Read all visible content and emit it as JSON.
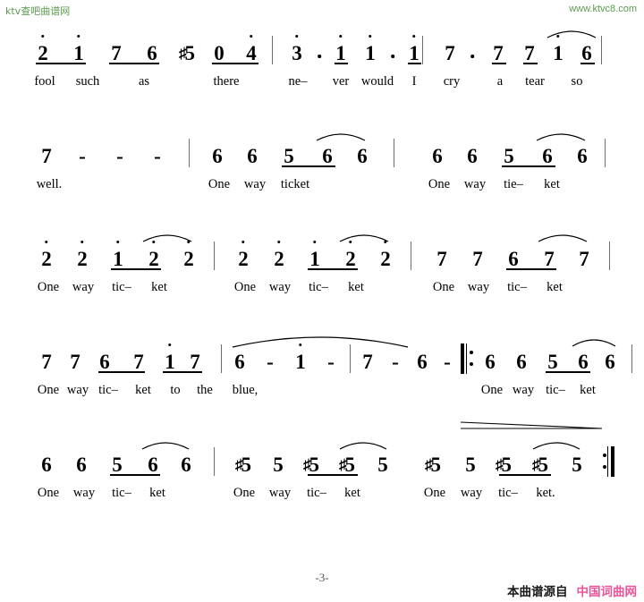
{
  "watermarks": {
    "left": "ktv查吧曲谱网",
    "right": "www.ktvc8.com",
    "left_color": "#5a9a4e",
    "right_color": "#5a9a4e"
  },
  "footer": {
    "page_number": "-3-",
    "source_label": "本曲谱源自",
    "source_site": "中国词曲网",
    "source_site_color": "#e8559a"
  },
  "score": {
    "notation": "jianpu",
    "systems": [
      {
        "index": 1,
        "measures": [
          {
            "notes": [
              {
                "num": "2",
                "octave": 1,
                "acc": "",
                "beam": "start"
              },
              {
                "num": "1",
                "octave": 1,
                "acc": "",
                "beam": "end"
              },
              {
                "num": "7",
                "octave": 0,
                "acc": "",
                "beam": "start"
              },
              {
                "num": "6",
                "octave": 0,
                "acc": "",
                "beam": "end"
              },
              {
                "num": "5",
                "octave": 0,
                "acc": "♯",
                "beam": "none"
              },
              {
                "num": "0",
                "octave": 0,
                "acc": "",
                "beam": "start"
              },
              {
                "num": "4",
                "octave": 1,
                "acc": "",
                "beam": "end"
              }
            ],
            "lyrics": [
              "fool",
              "such",
              "as",
              "there"
            ]
          },
          {
            "notes": [
              {
                "num": "3",
                "octave": 1,
                "acc": "",
                "beam": "none",
                "dotted": true
              },
              {
                "num": "1",
                "octave": 1,
                "acc": "",
                "beam": "single"
              },
              {
                "num": "1",
                "octave": 1,
                "acc": "",
                "beam": "none",
                "dotted": true
              },
              {
                "num": "1",
                "octave": 1,
                "acc": "",
                "beam": "single"
              }
            ],
            "lyrics": [
              "ne–",
              "ver",
              "would",
              "I"
            ]
          },
          {
            "notes": [
              {
                "num": "7",
                "octave": 0,
                "acc": "",
                "beam": "none",
                "dotted": true
              },
              {
                "num": "7",
                "octave": 0,
                "acc": "",
                "beam": "single"
              },
              {
                "num": "7",
                "octave": 0,
                "acc": "",
                "beam": "single"
              },
              {
                "num": "1",
                "octave": 1,
                "acc": "",
                "beam": "none"
              },
              {
                "num": "6",
                "octave": 0,
                "acc": "",
                "beam": "single"
              }
            ],
            "lyrics": [
              "cry",
              "a",
              "tear",
              "so"
            ],
            "slur": true
          }
        ]
      },
      {
        "index": 2,
        "measures": [
          {
            "notes": [
              {
                "num": "7",
                "octave": 0,
                "acc": "",
                "beam": "none"
              },
              {
                "num": "-"
              },
              {
                "num": "-"
              },
              {
                "num": "-"
              }
            ],
            "lyrics": [
              "well."
            ]
          },
          {
            "notes": [
              {
                "num": "6",
                "octave": 0,
                "acc": "",
                "beam": "none"
              },
              {
                "num": "6",
                "octave": 0,
                "acc": "",
                "beam": "none"
              },
              {
                "num": "5",
                "octave": 0,
                "acc": "",
                "beam": "start"
              },
              {
                "num": "6",
                "octave": 0,
                "acc": "",
                "beam": "end"
              },
              {
                "num": "6",
                "octave": 0,
                "acc": "",
                "beam": "none"
              }
            ],
            "lyrics": [
              "One",
              "way",
              "ticket"
            ],
            "slur": true
          },
          {
            "notes": [
              {
                "num": "6",
                "octave": 0,
                "acc": "",
                "beam": "none"
              },
              {
                "num": "6",
                "octave": 0,
                "acc": "",
                "beam": "none"
              },
              {
                "num": "5",
                "octave": 0,
                "acc": "",
                "beam": "start"
              },
              {
                "num": "6",
                "octave": 0,
                "acc": "",
                "beam": "end"
              },
              {
                "num": "6",
                "octave": 0,
                "acc": "",
                "beam": "none"
              }
            ],
            "lyrics": [
              "One",
              "way",
              "tie–",
              "ket"
            ],
            "slur": true
          }
        ]
      },
      {
        "index": 3,
        "measures": [
          {
            "notes": [
              {
                "num": "2",
                "octave": 1,
                "acc": "",
                "beam": "none"
              },
              {
                "num": "2",
                "octave": 1,
                "acc": "",
                "beam": "none"
              },
              {
                "num": "1",
                "octave": 1,
                "acc": "",
                "beam": "start"
              },
              {
                "num": "2",
                "octave": 1,
                "acc": "",
                "beam": "end"
              },
              {
                "num": "2",
                "octave": 1,
                "acc": "",
                "beam": "none"
              }
            ],
            "lyrics": [
              "One",
              "way",
              "tic–",
              "ket"
            ],
            "slur": true
          },
          {
            "notes": [
              {
                "num": "2",
                "octave": 1,
                "acc": "",
                "beam": "none"
              },
              {
                "num": "2",
                "octave": 1,
                "acc": "",
                "beam": "none"
              },
              {
                "num": "1",
                "octave": 1,
                "acc": "",
                "beam": "start"
              },
              {
                "num": "2",
                "octave": 1,
                "acc": "",
                "beam": "end"
              },
              {
                "num": "2",
                "octave": 1,
                "acc": "",
                "beam": "none"
              }
            ],
            "lyrics": [
              "One",
              "way",
              "tic–",
              "ket"
            ],
            "slur": true
          },
          {
            "notes": [
              {
                "num": "7",
                "octave": 0,
                "acc": "",
                "beam": "none"
              },
              {
                "num": "7",
                "octave": 0,
                "acc": "",
                "beam": "none"
              },
              {
                "num": "6",
                "octave": 0,
                "acc": "",
                "beam": "start"
              },
              {
                "num": "7",
                "octave": 0,
                "acc": "",
                "beam": "end"
              },
              {
                "num": "7",
                "octave": 0,
                "acc": "",
                "beam": "none"
              }
            ],
            "lyrics": [
              "One",
              "way",
              "tic–",
              "ket"
            ],
            "slur": true
          }
        ]
      },
      {
        "index": 4,
        "measures": [
          {
            "notes": [
              {
                "num": "7",
                "octave": 0,
                "acc": "",
                "beam": "none"
              },
              {
                "num": "7",
                "octave": 0,
                "acc": "",
                "beam": "none"
              },
              {
                "num": "6",
                "octave": 0,
                "acc": "",
                "beam": "start"
              },
              {
                "num": "7",
                "octave": 0,
                "acc": "",
                "beam": "end"
              },
              {
                "num": "1",
                "octave": 1,
                "acc": "",
                "beam": "start"
              },
              {
                "num": "7",
                "octave": 0,
                "acc": "",
                "beam": "end"
              }
            ],
            "lyrics": [
              "One",
              "way",
              "tic–",
              "ket",
              "to",
              "the"
            ]
          },
          {
            "notes": [
              {
                "num": "6",
                "octave": 0,
                "acc": "",
                "beam": "none"
              },
              {
                "num": "-"
              },
              {
                "num": "1",
                "octave": 1,
                "acc": "",
                "beam": "none"
              },
              {
                "num": "-"
              }
            ],
            "lyrics": [
              "blue,"
            ],
            "slur": true
          },
          {
            "notes": [
              {
                "num": "7",
                "octave": 0,
                "acc": "",
                "beam": "none"
              },
              {
                "num": "-"
              },
              {
                "num": "6",
                "octave": 0,
                "acc": "",
                "beam": "none"
              },
              {
                "num": "-"
              }
            ],
            "lyrics": []
          },
          {
            "repeat_start": true,
            "notes": [
              {
                "num": "6",
                "octave": 0,
                "acc": "",
                "beam": "none"
              },
              {
                "num": "6",
                "octave": 0,
                "acc": "",
                "beam": "none"
              },
              {
                "num": "5",
                "octave": 0,
                "acc": "",
                "beam": "start"
              },
              {
                "num": "6",
                "octave": 0,
                "acc": "",
                "beam": "end"
              },
              {
                "num": "6",
                "octave": 0,
                "acc": "",
                "beam": "none"
              }
            ],
            "lyrics": [
              "One",
              "way",
              "tic–",
              "ket"
            ],
            "slur": true
          }
        ]
      },
      {
        "index": 5,
        "measures": [
          {
            "notes": [
              {
                "num": "6",
                "octave": 0,
                "acc": "",
                "beam": "none"
              },
              {
                "num": "6",
                "octave": 0,
                "acc": "",
                "beam": "none"
              },
              {
                "num": "5",
                "octave": 0,
                "acc": "",
                "beam": "start"
              },
              {
                "num": "6",
                "octave": 0,
                "acc": "",
                "beam": "end"
              },
              {
                "num": "6",
                "octave": 0,
                "acc": "",
                "beam": "none"
              }
            ],
            "lyrics": [
              "One",
              "way",
              "tic–",
              "ket"
            ],
            "slur": true
          },
          {
            "notes": [
              {
                "num": "5",
                "octave": 0,
                "acc": "♯",
                "beam": "none"
              },
              {
                "num": "5",
                "octave": 0,
                "acc": "",
                "beam": "none"
              },
              {
                "num": "5",
                "octave": 0,
                "acc": "♯",
                "beam": "start"
              },
              {
                "num": "5",
                "octave": 0,
                "acc": "♯",
                "beam": "end"
              },
              {
                "num": "5",
                "octave": 0,
                "acc": "",
                "beam": "none"
              }
            ],
            "lyrics": [
              "One",
              "way",
              "tic–",
              "ket"
            ],
            "slur": true
          },
          {
            "repeat_end": true,
            "hairpin": "diminuendo",
            "notes": [
              {
                "num": "5",
                "octave": 0,
                "acc": "♯",
                "beam": "none"
              },
              {
                "num": "5",
                "octave": 0,
                "acc": "",
                "beam": "none"
              },
              {
                "num": "5",
                "octave": 0,
                "acc": "♯",
                "beam": "start"
              },
              {
                "num": "5",
                "octave": 0,
                "acc": "♯",
                "beam": "end"
              },
              {
                "num": "5",
                "octave": 0,
                "acc": "",
                "beam": "none"
              }
            ],
            "lyrics": [
              "One",
              "way",
              "tic–",
              "ket."
            ],
            "slur": true
          }
        ]
      }
    ]
  }
}
